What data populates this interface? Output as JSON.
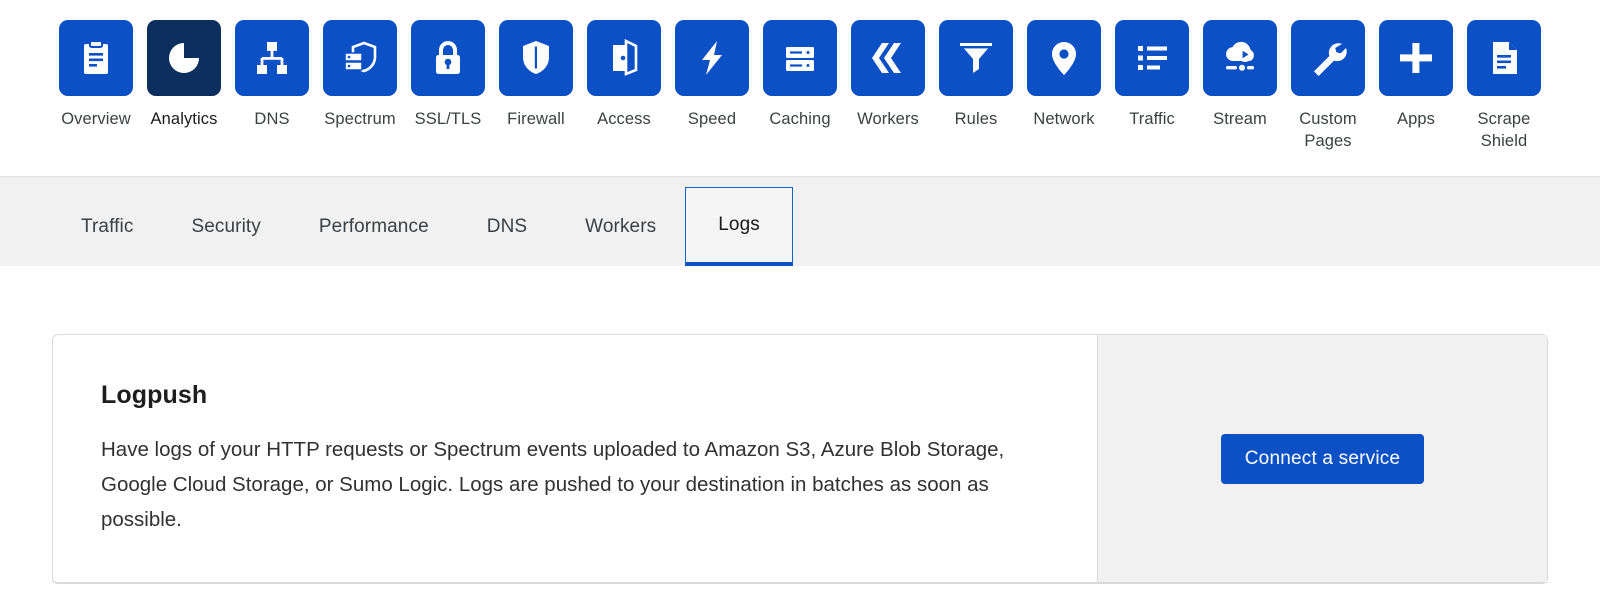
{
  "product_nav": {
    "items": [
      {
        "label": "Overview",
        "icon": "clipboard-icon",
        "active": false
      },
      {
        "label": "Analytics",
        "icon": "pie-chart-icon",
        "active": true
      },
      {
        "label": "DNS",
        "icon": "sitemap-icon",
        "active": false
      },
      {
        "label": "Spectrum",
        "icon": "server-shield-icon",
        "active": false
      },
      {
        "label": "SSL/TLS",
        "icon": "padlock-icon",
        "active": false
      },
      {
        "label": "Firewall",
        "icon": "shield-icon",
        "active": false
      },
      {
        "label": "Access",
        "icon": "open-door-icon",
        "active": false
      },
      {
        "label": "Speed",
        "icon": "lightning-bolt-icon",
        "active": false
      },
      {
        "label": "Caching",
        "icon": "server-rack-icon",
        "active": false
      },
      {
        "label": "Workers",
        "icon": "workers-chevron-icon",
        "active": false
      },
      {
        "label": "Rules",
        "icon": "funnel-icon",
        "active": false
      },
      {
        "label": "Network",
        "icon": "map-pin-icon",
        "active": false
      },
      {
        "label": "Traffic",
        "icon": "bulleted-list-icon",
        "active": false
      },
      {
        "label": "Stream",
        "icon": "cloud-play-icon",
        "active": false
      },
      {
        "label": "Custom Pages",
        "icon": "wrench-icon",
        "active": false
      },
      {
        "label": "Apps",
        "icon": "plus-icon",
        "active": false
      },
      {
        "label": "Scrape Shield",
        "icon": "document-icon",
        "active": false
      }
    ]
  },
  "tabs": {
    "items": [
      {
        "label": "Traffic",
        "selected": false
      },
      {
        "label": "Security",
        "selected": false
      },
      {
        "label": "Performance",
        "selected": false
      },
      {
        "label": "DNS",
        "selected": false
      },
      {
        "label": "Workers",
        "selected": false
      },
      {
        "label": "Logs",
        "selected": true
      }
    ]
  },
  "logpush": {
    "title": "Logpush",
    "description": "Have logs of your HTTP requests or Spectrum events uploaded to Amazon S3, Azure Blob Storage, Google Cloud Storage, or Sumo Logic. Logs are pushed to your destination in batches as soon as possible.",
    "connect_button_label": "Connect a service"
  },
  "colors": {
    "brand_blue": "#0b51c5",
    "active_navy": "#0c2f5e",
    "tab_strip_bg": "#f1f1f1",
    "card_border": "#d9d9d9"
  }
}
